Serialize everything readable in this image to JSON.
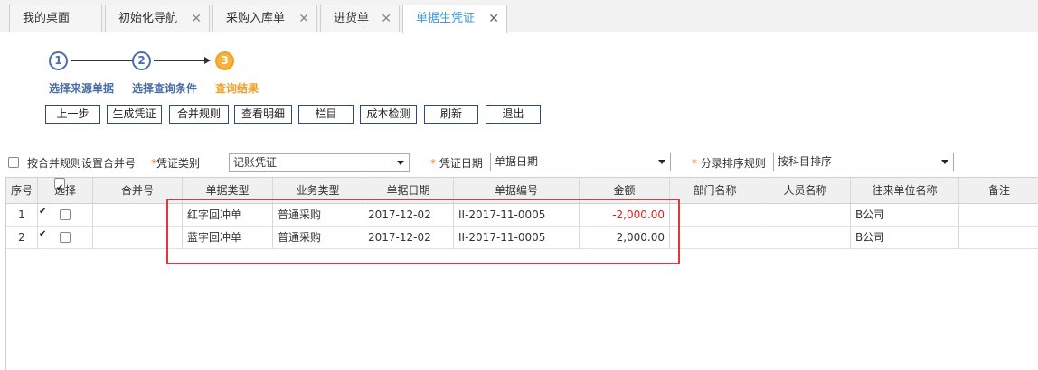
{
  "tabs": [
    {
      "label": "我的桌面",
      "closable": false
    },
    {
      "label": "初始化导航",
      "closable": true
    },
    {
      "label": "采购入库单",
      "closable": true
    },
    {
      "label": "进货单",
      "closable": true
    },
    {
      "label": "单据生凭证",
      "closable": true,
      "active": true
    }
  ],
  "steps": [
    {
      "number": "1",
      "label": "选择来源单据"
    },
    {
      "number": "2",
      "label": "选择查询条件"
    },
    {
      "number": "3",
      "label": "查询结果",
      "current": true
    }
  ],
  "toolbar": [
    "上一步",
    "生成凭证",
    "合并规则",
    "查看明细",
    "栏目",
    "成本检测",
    "刷新",
    "退出"
  ],
  "options": {
    "merge_checkbox_label": "按合并规则设置合并号",
    "merge_checked": false,
    "voucher_type_label": "凭证类别",
    "voucher_type_value": "记账凭证",
    "voucher_date_label": "凭证日期",
    "voucher_date_value": "单据日期",
    "sort_rule_label": "分录排序规则",
    "sort_rule_value": "按科目排序",
    "required_mark": "*"
  },
  "grid": {
    "headers": [
      "序号",
      "选择",
      "合并号",
      "单据类型",
      "业务类型",
      "单据日期",
      "单据编号",
      "金额",
      "部门名称",
      "人员名称",
      "往来单位名称",
      "备注"
    ],
    "select_all_checked": true,
    "rows": [
      {
        "index": "1",
        "selected": true,
        "merge_no": "",
        "doc_type": "红字回冲单",
        "biz_type": "普通采购",
        "doc_date": "2017-12-02",
        "doc_no": "II-2017-11-0005",
        "amount": "-2,000.00",
        "dept": "",
        "person": "",
        "partner": "B公司",
        "note": ""
      },
      {
        "index": "2",
        "selected": true,
        "merge_no": "",
        "doc_type": "蓝字回冲单",
        "biz_type": "普通采购",
        "doc_date": "2017-12-02",
        "doc_no": "II-2017-11-0005",
        "amount": "2,000.00",
        "dept": "",
        "person": "",
        "partner": "B公司",
        "note": ""
      }
    ]
  },
  "colors": {
    "accent": "#3a9ad9",
    "step_blue": "#4a6ea9",
    "step_current": "#f0a02a",
    "negative": "#e02020",
    "highlight_box": "#e0383e"
  }
}
